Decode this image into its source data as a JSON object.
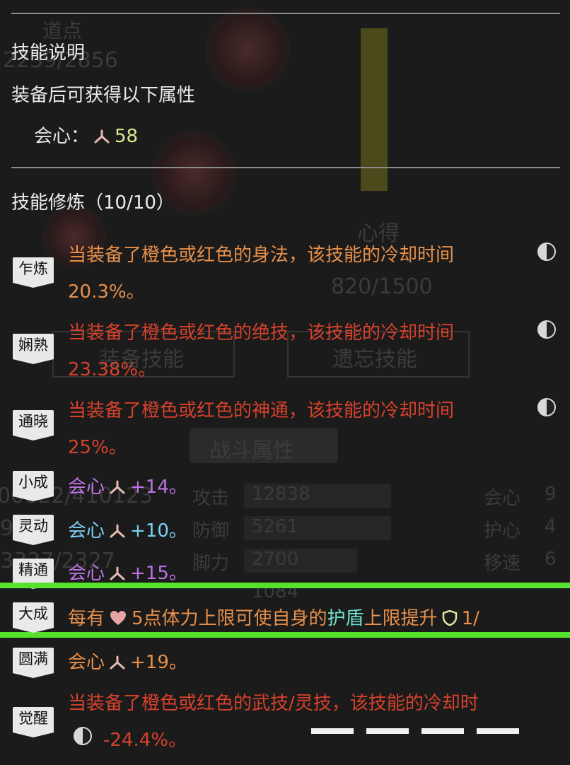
{
  "background": {
    "location_label": "道点",
    "progress_text": "2239/2856",
    "insight_label": "心得",
    "insight_value": "820/1500",
    "button_left": "装备技能",
    "button_right": "遗忘技能",
    "section_title": "战斗属性",
    "numbers": [
      "00622/410123",
      "9",
      "3327/2327"
    ],
    "stats": [
      {
        "label": "攻击",
        "value": "12838"
      },
      {
        "label": "防御",
        "value": "5261"
      },
      {
        "label": "脚力",
        "value": "2700"
      },
      {
        "label": "",
        "value": "1084"
      }
    ],
    "right_stats": [
      {
        "label": "会心",
        "value": "9"
      },
      {
        "label": "护心",
        "value": "4"
      },
      {
        "label": "移速",
        "value": "6"
      }
    ]
  },
  "skill_desc": {
    "title": "技能说明",
    "subtitle": "装备后可获得以下属性",
    "attr_label": "会心：",
    "attr_value": "58"
  },
  "training": {
    "title": "技能修炼（10/10）"
  },
  "levels": [
    {
      "badge": "乍炼",
      "text": "当装备了橙色或红色的身法，该技能的冷却时间",
      "value": "20.3%。"
    },
    {
      "badge": "娴熟",
      "text": "当装备了橙色或红色的绝技，该技能的冷却时间",
      "value": "23.38%。"
    },
    {
      "badge": "通晓",
      "text": "当装备了橙色或红色的神通，该技能的冷却时间",
      "value": "25%。"
    },
    {
      "badge": "小成",
      "label": "会心",
      "value": "+14。"
    },
    {
      "badge": "灵动",
      "label": "会心",
      "value": "+10。"
    },
    {
      "badge": "精通",
      "label": "会心",
      "value": "+15。"
    },
    {
      "badge": "大成",
      "pre": "每有",
      "mid": "5点体力上限可使自身的",
      "shield_word": "护盾",
      "post": "上限提升",
      "tail": "1/"
    },
    {
      "badge": "圆满",
      "label": "会心",
      "value": "+19。"
    },
    {
      "badge": "觉醒",
      "text": "当装备了橙色或红色的武技/灵技，该技能的冷却时",
      "value": "-24.4%。"
    }
  ],
  "colors": {
    "orange": "#e8904a",
    "red": "#d7412c",
    "purple": "#bd72e6",
    "blue": "#7bd1f4",
    "highlight": "#56e22c"
  }
}
